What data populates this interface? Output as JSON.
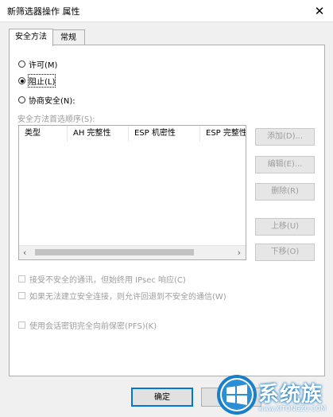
{
  "window": {
    "title": "新筛选器操作 属性",
    "close_glyph": "✕"
  },
  "tabs": [
    {
      "label": "安全方法",
      "active": true
    },
    {
      "label": "常规",
      "active": false
    }
  ],
  "radios": [
    {
      "label": "许可(M)",
      "checked": false
    },
    {
      "label": "阻止(L)",
      "checked": true
    },
    {
      "label": "协商安全(N):",
      "checked": false
    }
  ],
  "list": {
    "group_label": "安全方法首选顺序(S):",
    "columns": [
      "类型",
      "AH 完整性",
      "ESP 机密性",
      "ESP 完整性"
    ],
    "scroll_left_glyph": "‹",
    "scroll_right_glyph": "›"
  },
  "side_buttons": {
    "add": "添加(D)...",
    "edit": "编辑(E)...",
    "delete": "删除(R)",
    "move_up": "上移(U)",
    "move_down": "下移(O)"
  },
  "checkboxes": [
    {
      "label": "接受不安全的通讯，但始终用 IPsec 响应(C)",
      "checked": false
    },
    {
      "label": "如果无法建立安全连接，则允许回退到不安全的通信(W)",
      "checked": false
    },
    {
      "label": "使用会话密钥完全向前保密(PFS)(K)",
      "checked": false
    }
  ],
  "footer": {
    "ok_label": "确定"
  },
  "watermark": {
    "brand": "系统族",
    "url": "www.XITONGZU.COM"
  },
  "colors": {
    "accent": "#0078d7",
    "disabled_text": "#9d9d9d",
    "watermark_blue": "#1a7fc7"
  }
}
